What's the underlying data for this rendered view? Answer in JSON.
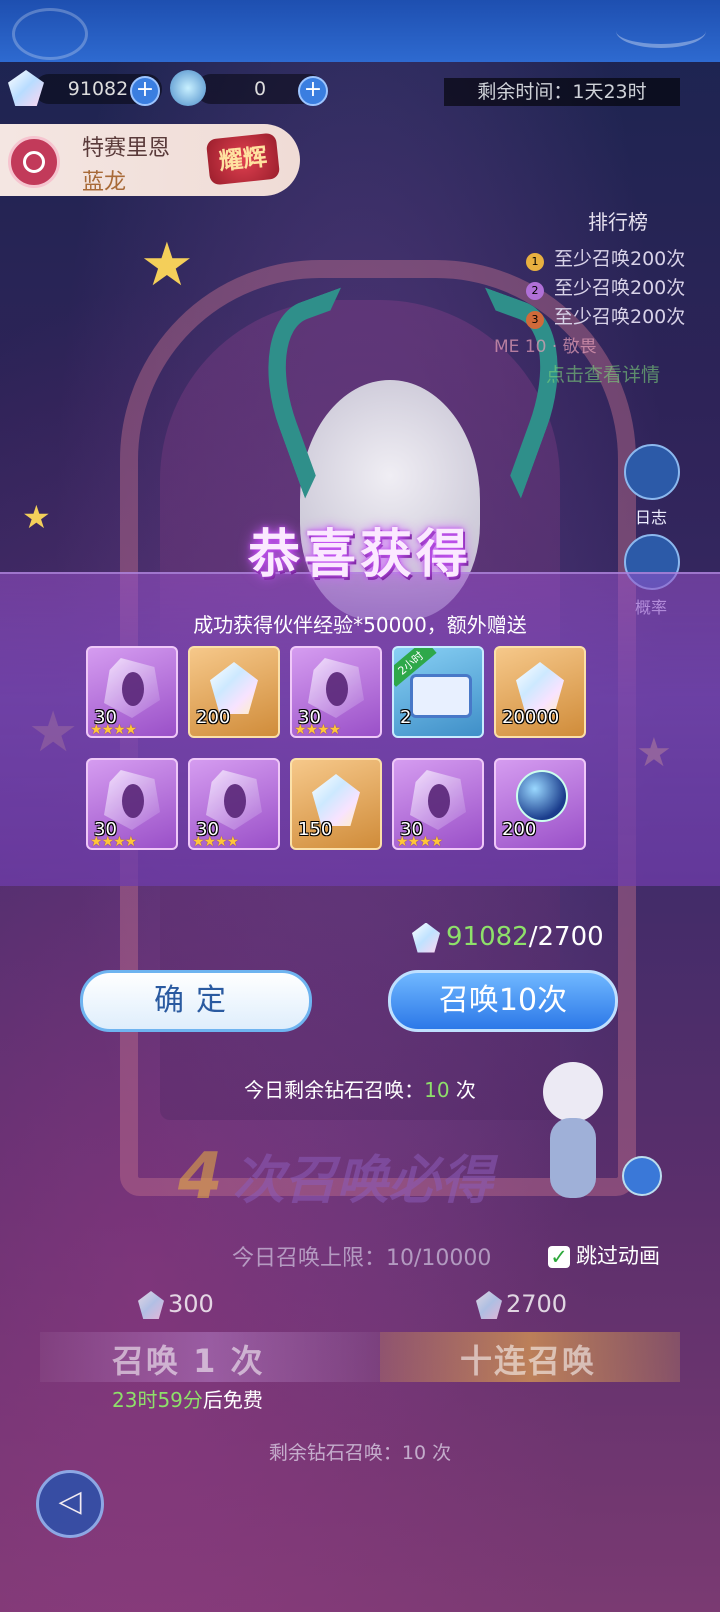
{
  "resources": {
    "diamonds": "91082",
    "tickets": "0"
  },
  "timer": "剩余时间：1天23时",
  "banner": {
    "name": "特赛里恩",
    "subtitle": "蓝龙",
    "badge": "耀辉"
  },
  "ranking": {
    "title": "排行榜",
    "rows": [
      {
        "medal": "1",
        "text": "至少召唤200次",
        "color": "#e8b040"
      },
      {
        "medal": "2",
        "text": "至少召唤200次",
        "color": "#b070d8"
      },
      {
        "medal": "3",
        "text": "至少召唤200次",
        "color": "#d06a3a"
      }
    ],
    "me_row": "ME 10 · 敬畏",
    "detail_link": "点击查看详情"
  },
  "side_buttons": {
    "log": "日志",
    "probability": "概率"
  },
  "dialog": {
    "title": "恭喜获得",
    "subtitle": "成功获得伙伴经验*50000，额外赠送",
    "items": [
      {
        "type": "shard",
        "qty": "30",
        "stars": "★★★★"
      },
      {
        "type": "gem",
        "qty": "200",
        "stars": ""
      },
      {
        "type": "shard",
        "qty": "30",
        "stars": "★★★★"
      },
      {
        "type": "chest",
        "qty": "2",
        "stars": "",
        "tag": "2小时"
      },
      {
        "type": "gem",
        "qty": "20000",
        "stars": ""
      },
      {
        "type": "shard",
        "qty": "30",
        "stars": "★★★★"
      },
      {
        "type": "shard",
        "qty": "30",
        "stars": "★★★★"
      },
      {
        "type": "gem",
        "qty": "150",
        "stars": ""
      },
      {
        "type": "shard",
        "qty": "30",
        "stars": "★★★★"
      },
      {
        "type": "orb",
        "qty": "200",
        "stars": ""
      }
    ],
    "cost_have": "91082",
    "cost_need": "/2700",
    "confirm_label": "确定",
    "summon10_label": "召唤10次"
  },
  "today_summon": {
    "prefix": "今日剩余钻石召唤：",
    "count": "10",
    "suffix": " 次"
  },
  "lower": {
    "guarantee_num": "4",
    "guarantee_text": "次召唤必得",
    "limit": "今日召唤上限：10/10000",
    "skip_label": "跳过动画",
    "price_single": "300",
    "price_ten": "2700",
    "single_label": "召唤 1 次",
    "ten_label": "十连召唤",
    "free_time": "23时59分",
    "free_suffix": "后免费",
    "remain": "剩余钻石召唤：10 次"
  },
  "icons": {
    "back": "back-arrow-icon"
  }
}
